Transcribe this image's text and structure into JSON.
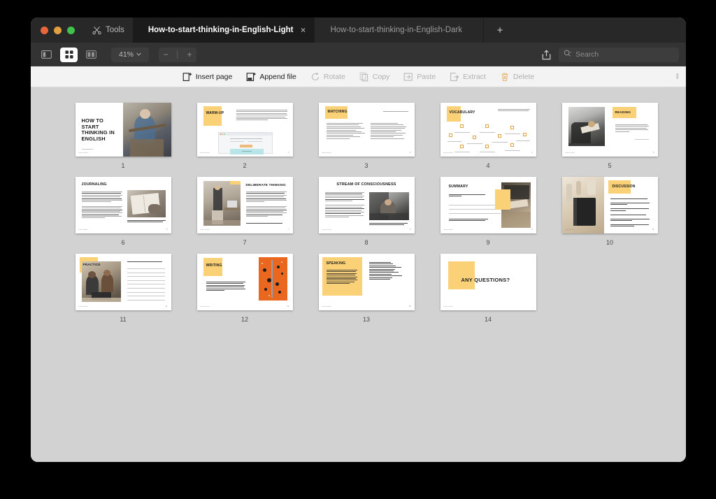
{
  "window": {
    "titlebar": {
      "tools_label": "Tools",
      "tools_icon": "scissors-icon",
      "tabs": [
        {
          "label": "How-to-start-thinking-in-English-Light",
          "active": true,
          "close_glyph": "×"
        },
        {
          "label": "How-to-start-thinking-in-English-Dark",
          "active": false
        }
      ],
      "add_tab_glyph": "+"
    },
    "toolbar": {
      "view_modes": [
        {
          "name": "sidebar-view",
          "active": false
        },
        {
          "name": "grid-view",
          "active": true
        },
        {
          "name": "split-view",
          "active": false
        }
      ],
      "zoom_level": "41%",
      "zoom_chevron": "⌄",
      "zoom_out_glyph": "−",
      "zoom_in_glyph": "+",
      "share_icon": "share-icon",
      "search_placeholder": "Search",
      "search_value": "",
      "search_icon": "search-icon"
    },
    "actionbar": {
      "actions": [
        {
          "label": "Insert page",
          "icon": "insert-page-icon",
          "enabled": true
        },
        {
          "label": "Append file",
          "icon": "append-file-icon",
          "enabled": true
        },
        {
          "label": "Rotate",
          "icon": "rotate-icon",
          "enabled": false
        },
        {
          "label": "Copy",
          "icon": "copy-icon",
          "enabled": false
        },
        {
          "label": "Paste",
          "icon": "paste-icon",
          "enabled": false
        },
        {
          "label": "Extract",
          "icon": "extract-icon",
          "enabled": false
        },
        {
          "label": "Delete",
          "icon": "trash-icon",
          "enabled": false
        }
      ],
      "grip_glyph": "‖"
    }
  },
  "colors": {
    "accent_yellow": "#fbd178",
    "accent_orange": "#ea6720",
    "titlebar": "#282828",
    "toolbar": "#333333",
    "actionbar": "#f3f3f3",
    "canvas": "#d2d2d2"
  },
  "pages": [
    {
      "number": "1",
      "layout": "title-photo",
      "title": "HOW TO START THINKING IN ENGLISH",
      "footer": "how-to-think"
    },
    {
      "number": "2",
      "layout": "warmup",
      "title": "WARM-UP",
      "footer": "how-to-think"
    },
    {
      "number": "3",
      "layout": "matching",
      "title": "MATCHING",
      "note": "Match the sentence halves",
      "footer": "how-to-think"
    },
    {
      "number": "4",
      "layout": "vocabulary",
      "title": "VOCABULARY",
      "note": "Look at the sentences on page 3 and find the words which mean the following",
      "footer": "how-to-think"
    },
    {
      "number": "5",
      "layout": "reading",
      "title": "READING",
      "body": "You'll read 3 strategies how to start thinking in English. Take turns with your classmates or teacher, focus on new words, and answer the questions after each part.",
      "footer": "how-to-think"
    },
    {
      "number": "6",
      "layout": "journaling",
      "title": "JOURNALING",
      "caption": "Have you ever given journaling a try? If yes, what did you write about, and what was your experience?",
      "footer": "how-to-think"
    },
    {
      "number": "7",
      "layout": "deliberate",
      "title": "DELIBERATE THINKING",
      "caption": "Do you think it would be possible for you to do it regularly?",
      "footer": "how-to-think"
    },
    {
      "number": "8",
      "layout": "stream",
      "title": "STREAM OF CONSCIOUSNESS",
      "caption": "What thoughts are going through your mind right now? Can you share them with me, now?",
      "footer": "how-to-think"
    },
    {
      "number": "9",
      "layout": "summary",
      "title": "SUMMARY",
      "note": "So, try introducing these simple strategies into your daily life:",
      "body": "You'll gradually become more comfortable and fluent in English, without constantly translating in your head.",
      "footer": "how-to-think"
    },
    {
      "number": "10",
      "layout": "discussion",
      "title": "DISCUSSION",
      "footer": "how-to-think"
    },
    {
      "number": "11",
      "layout": "practice",
      "title": "PRACTICE",
      "note": "Write an example sentence with each word",
      "footer": "how-to-think"
    },
    {
      "number": "12",
      "layout": "writing",
      "title": "WRITING",
      "body": "Get those so-called prompts. Try and write what's coming to your mind for 5 minutes. There's no need to craft simply jot down everything that crosses your mind short or long sentences, words, phrases, etc. Then, you'll read it aloud to the class.",
      "footer": "how-to-think"
    },
    {
      "number": "13",
      "layout": "speaking",
      "title": "SPEAKING",
      "body": "An important or easy focus on your own ideas, especially when your and it's filled with different random thoughts. Choose a topic from the list and speak about it for 2-3 minutes. Your classmates or teacher will then interrupt you with different questions. Your task is to answer these questions briefly while deep-diving back into the main topic.",
      "footer": "how-to-think"
    },
    {
      "number": "14",
      "layout": "any-questions",
      "title": "ANY QUESTIONS?",
      "footer": "how-to-think"
    }
  ]
}
